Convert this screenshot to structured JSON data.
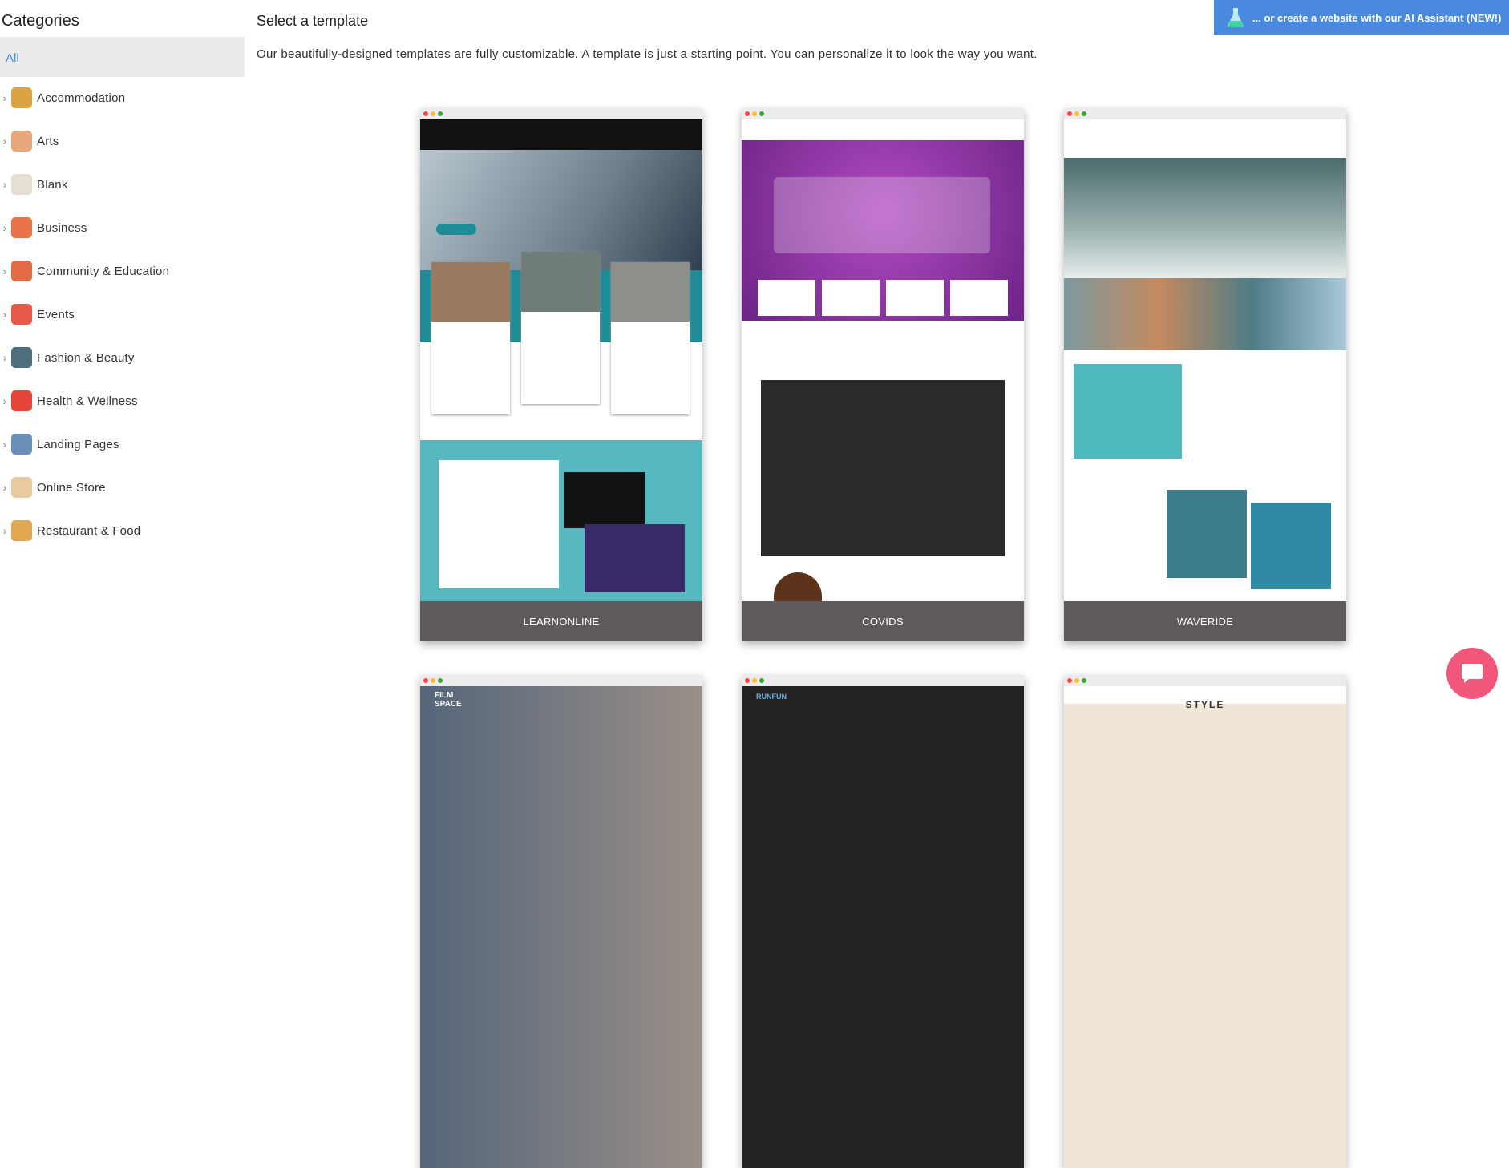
{
  "sidebar": {
    "title": "Categories",
    "all": "All",
    "items": [
      {
        "label": "Accommodation",
        "icon": "hut-icon",
        "color": "#d9a441"
      },
      {
        "label": "Arts",
        "icon": "palette-icon",
        "color": "#e8a87c"
      },
      {
        "label": "Blank",
        "icon": "blank-page-icon",
        "color": "#e6ded2"
      },
      {
        "label": "Business",
        "icon": "storefront-icon",
        "color": "#e9744a"
      },
      {
        "label": "Community & Education",
        "icon": "people-icon",
        "color": "#e06b45"
      },
      {
        "label": "Events",
        "icon": "calendar-icon",
        "color": "#e75a4a"
      },
      {
        "label": "Fashion & Beauty",
        "icon": "woman-icon",
        "color": "#4e6d7d"
      },
      {
        "label": "Health & Wellness",
        "icon": "heart-pulse-icon",
        "color": "#e5463a"
      },
      {
        "label": "Landing Pages",
        "icon": "browser-icon",
        "color": "#6a8fb8"
      },
      {
        "label": "Online Store",
        "icon": "box-icon",
        "color": "#e8c9a0"
      },
      {
        "label": "Restaurant & Food",
        "icon": "grocery-bag-icon",
        "color": "#e0a850"
      }
    ]
  },
  "main": {
    "title": "Select a template",
    "description": "Our beautifully-designed templates are fully customizable. A template is just a starting point. You can personalize it to look the way you want."
  },
  "ai_button": {
    "label": "... or create a website with our AI Assistant (NEW!)",
    "icon": "flask-icon",
    "color": "#4a8ade"
  },
  "templates": [
    {
      "name": "LEARNONLINE"
    },
    {
      "name": "COVIDS"
    },
    {
      "name": "WAVERIDE"
    },
    {
      "name": "FILM SPACE"
    },
    {
      "name": "RUNFUN"
    },
    {
      "name": "STYLE"
    }
  ],
  "chat": {
    "icon": "chat-bubble-icon",
    "color": "#f0577a"
  }
}
